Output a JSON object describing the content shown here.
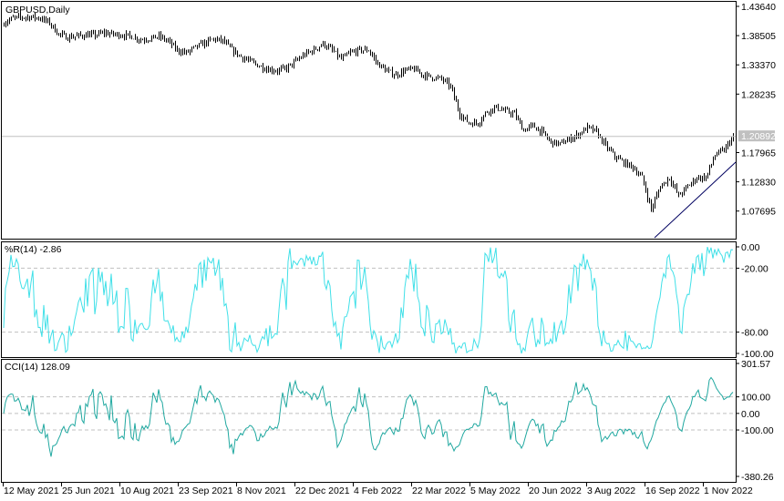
{
  "window": {
    "symbol_label": "GBPUSD,Daily"
  },
  "colors": {
    "background": "#ffffff",
    "bars": "#000000",
    "williams_r": "#40e0e8",
    "cci": "#20a8a0",
    "grid_levels": "#c0c0c0",
    "price_line": "#c0c0c0",
    "trendline": "#000060"
  },
  "chart_data": [
    {
      "type": "ohlc-bar",
      "title": "GBPUSD,Daily",
      "current_price": "1.20892",
      "current_price_value": 1.20892,
      "ylim": [
        1.0285,
        1.446
      ],
      "y_ticks": [
        "1.43640",
        "1.38505",
        "1.33370",
        "1.28235",
        "1.17965",
        "1.12830",
        "1.07695"
      ],
      "x_ticks": [
        "12 May 2021",
        "25 Jun 2021",
        "10 Aug 2021",
        "23 Sep 2021",
        "8 Nov 2021",
        "22 Dec 2021",
        "4 Feb 2022",
        "22 Mar 2022",
        "5 May 2022",
        "20 Jun 2022",
        "3 Aug 2022",
        "16 Sep 2022",
        "1 Nov 2022"
      ],
      "x_range": [
        "12 May 2021",
        "Nov 2022"
      ],
      "close_keypoints_evenly_spaced": [
        1.4076,
        1.4156,
        1.4172,
        1.418,
        1.4156,
        1.4076,
        1.3876,
        1.382,
        1.3844,
        1.386,
        1.386,
        1.39,
        1.3876,
        1.386,
        1.3836,
        1.378,
        1.38,
        1.3836,
        1.3756,
        1.3596,
        1.3548,
        1.3644,
        1.372,
        1.379,
        1.376,
        1.36,
        1.348,
        1.34,
        1.332,
        1.326,
        1.3236,
        1.328,
        1.34,
        1.352,
        1.36,
        1.3708,
        1.3596,
        1.3436,
        1.3548,
        1.3596,
        1.3596,
        1.3356,
        1.3228,
        1.316,
        1.324,
        1.326,
        1.316,
        1.3116,
        1.309,
        1.2956,
        1.2476,
        1.2316,
        1.2316,
        1.2524,
        1.2588,
        1.2524,
        1.2476,
        1.2188,
        1.2268,
        1.216,
        1.198,
        1.1948,
        1.203,
        1.2116,
        1.2236,
        1.2156,
        1.1916,
        1.173,
        1.162,
        1.154,
        1.1356,
        1.08,
        1.12,
        1.1356,
        1.1036,
        1.12,
        1.1356,
        1.1356,
        1.1756,
        1.1836,
        1.2089
      ],
      "trendline": {
        "from": {
          "date": "26 Sep 2022",
          "price": 1.03
        },
        "to": {
          "date": "Nov 2022",
          "price": 1.1628
        }
      }
    },
    {
      "type": "line",
      "title": "%R(14) -2.86",
      "indicator": "Williams %R",
      "period": 14,
      "last_value": -2.86,
      "ylim": [
        -100,
        0
      ],
      "y_ticks": [
        "0.00",
        "-20.00",
        "-80.00",
        "-100.00"
      ],
      "levels": [
        -20,
        -80
      ]
    },
    {
      "type": "line",
      "title": "CCI(14) 128.09",
      "indicator": "CCI",
      "period": 14,
      "last_value": 128.09,
      "ylim": [
        -380.26,
        301.57
      ],
      "y_ticks": [
        "301.57",
        "100.00",
        "0.00",
        "-100.00",
        "-380.26"
      ],
      "levels": [
        100,
        0,
        -100
      ]
    }
  ]
}
